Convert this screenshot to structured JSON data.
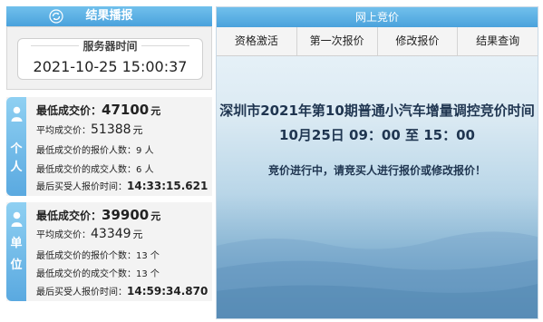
{
  "left": {
    "header_title": "结果播报",
    "server_time_label": "服务器时间",
    "server_time": "2021-10-25 15:00:37"
  },
  "individual": {
    "tab_chars": [
      "个",
      "人"
    ],
    "lowest_price_label": "最低成交价：",
    "lowest_price": "47100",
    "avg_price_label": "平均成交价：",
    "avg_price": "51388",
    "lowest_bid_count_label": "最低成交价的报价人数：",
    "lowest_bid_count": "9",
    "lowest_deal_count_label": "最低成交价的成交人数：",
    "lowest_deal_count": "6",
    "last_bid_time_label": "最后买受人报价时间：",
    "last_bid_time": "14:33:15.621",
    "unit_yuan": "元",
    "unit_person": "人"
  },
  "company": {
    "tab_chars": [
      "单",
      "位"
    ],
    "lowest_price_label": "最低成交价：",
    "lowest_price": "39900",
    "avg_price_label": "平均成交价：",
    "avg_price": "43349",
    "lowest_bid_count_label": "最低成交价的报价个数：",
    "lowest_bid_count": "13",
    "lowest_deal_count_label": "最低成交价的成交个数：",
    "lowest_deal_count": "13",
    "last_bid_time_label": "最后买受人报价时间：",
    "last_bid_time": "14:59:34.870",
    "unit_yuan": "元",
    "unit_count": "个"
  },
  "right": {
    "header_title": "网上竞价",
    "tabs": [
      "资格激活",
      "第一次报价",
      "修改报价",
      "结果查询"
    ],
    "auction_title": "深圳市2021年第10期普通小汽车增量调控竞价时间",
    "auction_time": "10月25日 09：00 至 15：00",
    "auction_status": "竞价进行中，请竞买人进行报价或修改报价！"
  },
  "colors": {
    "header_blue": "#4aa2dc",
    "text_dark_blue": "#1f3550"
  }
}
